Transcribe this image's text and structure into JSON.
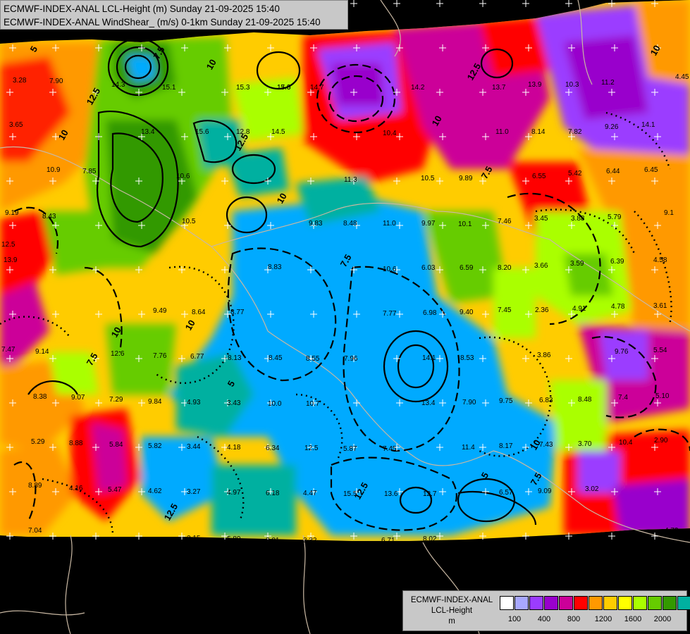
{
  "header": {
    "line1": "ECMWF-INDEX-ANAL LCL-Height (m) Sunday 21-09-2025 15:40",
    "line2": "ECMWF-INDEX-ANAL WindShear_ (m/s) 0-1km Sunday 21-09-2025 15:40"
  },
  "legend": {
    "line1": "ECMWF-INDEX-ANAL",
    "line2": "LCL-Height",
    "line3": "m",
    "colors": [
      "#ffffff",
      "#a8a8ff",
      "#9b3cff",
      "#9900cc",
      "#cc0099",
      "#ff0000",
      "#ff9900",
      "#ffcc00",
      "#ffff00",
      "#aaff00",
      "#66cc00",
      "#339900",
      "#00b0a0",
      "#00aaff"
    ],
    "ticks": [
      "100",
      "400",
      "800",
      "1200",
      "1600",
      "2000"
    ]
  },
  "map_labels": [
    {
      "t": "3.28"
    },
    {
      "t": "7.90"
    },
    {
      "t": "15.1"
    },
    {
      "t": "14.3"
    },
    {
      "t": "17.0"
    },
    {
      "t": "15.3"
    },
    {
      "t": "15.8"
    },
    {
      "t": "14.7"
    },
    {
      "t": "14.2"
    },
    {
      "t": "13.7"
    },
    {
      "t": "13.9"
    },
    {
      "t": "10.3"
    },
    {
      "t": "11.2"
    },
    {
      "t": "4.45"
    },
    {
      "t": "3.65"
    },
    {
      "t": "13.4"
    },
    {
      "t": "15.6"
    },
    {
      "t": "12.8"
    },
    {
      "t": "14.5"
    },
    {
      "t": "10.4"
    },
    {
      "t": "11.0"
    },
    {
      "t": "8.14"
    },
    {
      "t": "7.82"
    },
    {
      "t": "9.26"
    },
    {
      "t": "14.1"
    },
    {
      "t": "10.9"
    },
    {
      "t": "7.85"
    },
    {
      "t": "10.6"
    },
    {
      "t": "11.3"
    },
    {
      "t": "10.5"
    },
    {
      "t": "9.89"
    },
    {
      "t": "6.55"
    },
    {
      "t": "5.42"
    },
    {
      "t": "6.44"
    },
    {
      "t": "6.45"
    },
    {
      "t": "9.19"
    },
    {
      "t": "8.43"
    },
    {
      "t": "10.5"
    },
    {
      "t": "9.83"
    },
    {
      "t": "8.48"
    },
    {
      "t": "11.0"
    },
    {
      "t": "9.97"
    },
    {
      "t": "10.1"
    },
    {
      "t": "7.46"
    },
    {
      "t": "3.45"
    },
    {
      "t": "3.88"
    },
    {
      "t": "5.79"
    },
    {
      "t": "9.1"
    },
    {
      "t": "12.5"
    },
    {
      "t": "13.9"
    },
    {
      "t": "8.83"
    },
    {
      "t": "10.6"
    },
    {
      "t": "6.03"
    },
    {
      "t": "6.59"
    },
    {
      "t": "8.20"
    },
    {
      "t": "3.66"
    },
    {
      "t": "3.59"
    },
    {
      "t": "6.39"
    },
    {
      "t": "4.58"
    },
    {
      "t": "9.49"
    },
    {
      "t": "8.64"
    },
    {
      "t": "8.77"
    },
    {
      "t": "7.77"
    },
    {
      "t": "6.98"
    },
    {
      "t": "9.40"
    },
    {
      "t": "7.45"
    },
    {
      "t": "2.36"
    },
    {
      "t": "4.91"
    },
    {
      "t": "4.78"
    },
    {
      "t": "3.61"
    },
    {
      "t": "7.47"
    },
    {
      "t": "9.14"
    },
    {
      "t": "12.6"
    },
    {
      "t": "7.76"
    },
    {
      "t": "6.77"
    },
    {
      "t": "8.13"
    },
    {
      "t": "8.45"
    },
    {
      "t": "8.55"
    },
    {
      "t": "7.96"
    },
    {
      "t": "14.1"
    },
    {
      "t": "8.53"
    },
    {
      "t": "3.86"
    },
    {
      "t": "9.76"
    },
    {
      "t": "5.54"
    },
    {
      "t": "8.38"
    },
    {
      "t": "9.07"
    },
    {
      "t": "7.29"
    },
    {
      "t": "9.84"
    },
    {
      "t": "4.93"
    },
    {
      "t": "3.43"
    },
    {
      "t": "10.0"
    },
    {
      "t": "10.7"
    },
    {
      "t": "13.4"
    },
    {
      "t": "7.90"
    },
    {
      "t": "9.75"
    },
    {
      "t": "6.83"
    },
    {
      "t": "8.48"
    },
    {
      "t": "7.4"
    },
    {
      "t": "5.10"
    },
    {
      "t": "5.29"
    },
    {
      "t": "8.88"
    },
    {
      "t": "5.84"
    },
    {
      "t": "5.82"
    },
    {
      "t": "3.44"
    },
    {
      "t": "4.18"
    },
    {
      "t": "6.34"
    },
    {
      "t": "12.5"
    },
    {
      "t": "5.87"
    },
    {
      "t": "7.45"
    },
    {
      "t": "11.4"
    },
    {
      "t": "8.17"
    },
    {
      "t": "7.43"
    },
    {
      "t": "3.70"
    },
    {
      "t": "10.4"
    },
    {
      "t": "2.90"
    },
    {
      "t": "8.89"
    },
    {
      "t": "4.16"
    },
    {
      "t": "5.47"
    },
    {
      "t": "4.62"
    },
    {
      "t": "3.27"
    },
    {
      "t": "4.97"
    },
    {
      "t": "6.18"
    },
    {
      "t": "4.47"
    },
    {
      "t": "15.5"
    },
    {
      "t": "13.6"
    },
    {
      "t": "12.7"
    },
    {
      "t": "6.57"
    },
    {
      "t": "9.09"
    },
    {
      "t": "3.02"
    },
    {
      "t": "7.04"
    },
    {
      "t": "2.15"
    },
    {
      "t": "5.80"
    },
    {
      "t": "3.01"
    },
    {
      "t": "3.32"
    },
    {
      "t": "6.71"
    },
    {
      "t": "8.02"
    },
    {
      "t": "4.72"
    }
  ],
  "contour_labels": [
    {
      "t": "5"
    },
    {
      "t": "10"
    },
    {
      "t": "12.5"
    },
    {
      "t": "7.5"
    },
    {
      "t": "10"
    },
    {
      "t": "12.5"
    },
    {
      "t": "10"
    },
    {
      "t": "7.5"
    },
    {
      "t": "10"
    },
    {
      "t": "12.5"
    },
    {
      "t": "10"
    },
    {
      "t": "7.5"
    },
    {
      "t": "10"
    },
    {
      "t": "5"
    },
    {
      "t": "7.5"
    },
    {
      "t": "10"
    },
    {
      "t": "12.5"
    },
    {
      "t": "5"
    },
    {
      "t": "12.5"
    },
    {
      "t": "10"
    },
    {
      "t": "7.5"
    }
  ]
}
